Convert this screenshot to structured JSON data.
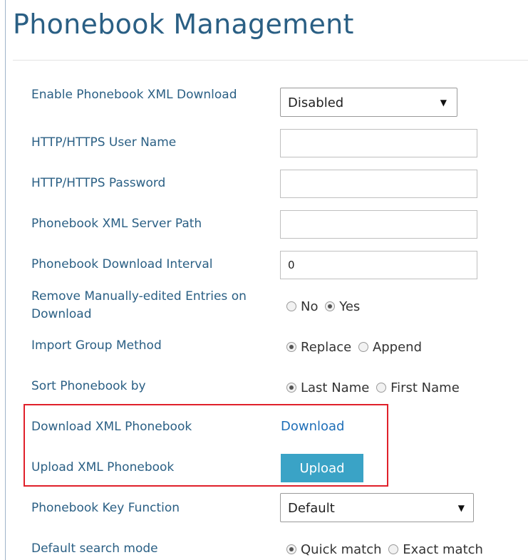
{
  "page": {
    "title": "Phonebook Management"
  },
  "fields": {
    "enable_xml_download": {
      "label": "Enable Phonebook XML Download",
      "value": "Disabled"
    },
    "http_user": {
      "label": "HTTP/HTTPS User Name",
      "value": ""
    },
    "http_password": {
      "label": "HTTP/HTTPS Password",
      "value": ""
    },
    "server_path": {
      "label": "Phonebook XML Server Path",
      "value": ""
    },
    "download_interval": {
      "label": "Phonebook Download Interval",
      "value": "0"
    },
    "remove_manual": {
      "label": "Remove Manually-edited Entries on Download",
      "options": [
        "No",
        "Yes"
      ],
      "selected": "Yes"
    },
    "import_group": {
      "label": "Import Group Method",
      "options": [
        "Replace",
        "Append"
      ],
      "selected": "Replace"
    },
    "sort_by": {
      "label": "Sort Phonebook by",
      "options": [
        "Last Name",
        "First Name"
      ],
      "selected": "Last Name"
    },
    "download_xml": {
      "label": "Download XML Phonebook",
      "link_text": "Download"
    },
    "upload_xml": {
      "label": "Upload XML Phonebook",
      "button_text": "Upload"
    },
    "key_function": {
      "label": "Phonebook Key Function",
      "value": "Default"
    },
    "search_mode": {
      "label": "Default search mode",
      "options": [
        "Quick match",
        "Exact match"
      ],
      "selected": "Quick match"
    }
  },
  "icons": {
    "dropdown": "caret-down-icon"
  },
  "colors": {
    "label": "#2a5f84",
    "link": "#1f6fb8",
    "button": "#3aa3c6",
    "highlight": "#e0202a"
  }
}
